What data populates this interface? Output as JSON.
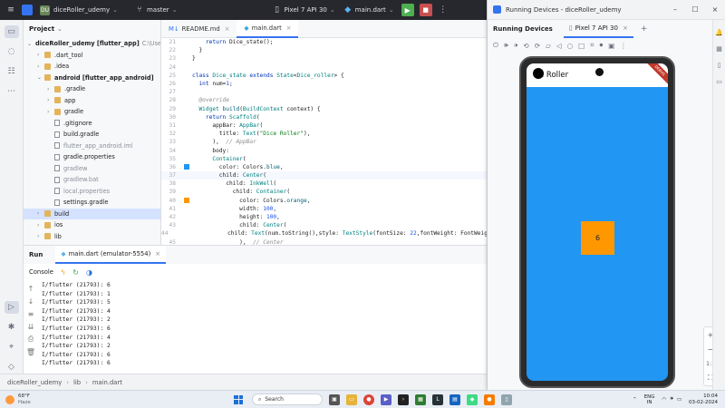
{
  "titlebar": {
    "project_badge": "DU",
    "project_name": "diceRoller_udemy",
    "branch": "master",
    "device": "Pixel 7 API 30",
    "run_config": "main.dart"
  },
  "project_panel": {
    "title": "Project",
    "tree": [
      {
        "label": "diceRoller_udemy [flutter_app]",
        "extra": "C:\\Users\\",
        "indent": 0,
        "kind": "folder-blue",
        "expanded": true,
        "bold": true
      },
      {
        "label": ".dart_tool",
        "indent": 1,
        "kind": "folder",
        "expanded": false
      },
      {
        "label": ".idea",
        "indent": 1,
        "kind": "folder",
        "expanded": false
      },
      {
        "label": "android [flutter_app_android]",
        "indent": 1,
        "kind": "folder",
        "expanded": true,
        "bold": true
      },
      {
        "label": ".gradle",
        "indent": 2,
        "kind": "folder",
        "expanded": false
      },
      {
        "label": "app",
        "indent": 2,
        "kind": "folder",
        "expanded": false
      },
      {
        "label": "gradle",
        "indent": 2,
        "kind": "folder",
        "expanded": false
      },
      {
        "label": ".gitignore",
        "indent": 2,
        "kind": "file"
      },
      {
        "label": "build.gradle",
        "indent": 2,
        "kind": "file"
      },
      {
        "label": "flutter_app_android.iml",
        "indent": 2,
        "kind": "file",
        "muted": true
      },
      {
        "label": "gradle.properties",
        "indent": 2,
        "kind": "file"
      },
      {
        "label": "gradlew",
        "indent": 2,
        "kind": "file",
        "muted": true
      },
      {
        "label": "gradlew.bat",
        "indent": 2,
        "kind": "file",
        "muted": true
      },
      {
        "label": "local.properties",
        "indent": 2,
        "kind": "file",
        "muted": true
      },
      {
        "label": "settings.gradle",
        "indent": 2,
        "kind": "file"
      },
      {
        "label": "build",
        "indent": 1,
        "kind": "folder",
        "expanded": false,
        "selected": true
      },
      {
        "label": "ios",
        "indent": 1,
        "kind": "folder",
        "expanded": false
      },
      {
        "label": "lib",
        "indent": 1,
        "kind": "folder",
        "expanded": false
      }
    ]
  },
  "editor": {
    "tabs": [
      {
        "label": "README.md",
        "prefix": "M↓",
        "active": false
      },
      {
        "label": "main.dart",
        "active": true
      }
    ],
    "lines": [
      {
        "n": "21",
        "html": "    <span class='kw'>return</span> Dice_state();"
      },
      {
        "n": "22",
        "html": "  }"
      },
      {
        "n": "23",
        "html": "}"
      },
      {
        "n": "24",
        "html": ""
      },
      {
        "n": "25",
        "html": "<span class='kw'>class</span> <span class='cls'>Dice_state</span> <span class='kw'>extends</span> <span class='cls'>State</span>&lt;<span class='cls'>Dice_roller</span>&gt; {"
      },
      {
        "n": "26",
        "html": "  <span class='kw'>int</span> num=<span class='num'>1</span>;"
      },
      {
        "n": "27",
        "html": ""
      },
      {
        "n": "28",
        "html": "  <span class='cm'>@override</span>"
      },
      {
        "n": "29",
        "html": "  <span class='cls'>Widget</span> <span class='fn'>build</span>(<span class='cls'>BuildContext</span> context) {"
      },
      {
        "n": "30",
        "html": "    <span class='kw'>return</span> <span class='cls'>Scaffold</span>("
      },
      {
        "n": "31",
        "html": "      appBar: <span class='cls'>AppBar</span>("
      },
      {
        "n": "32",
        "html": "        title: <span class='cls'>Text</span>(<span class='str'>\"Dice Roller\"</span>),"
      },
      {
        "n": "33",
        "html": "      ),  <span class='cm'>// AppBar</span>"
      },
      {
        "n": "34",
        "html": "      body:"
      },
      {
        "n": "35",
        "html": "      <span class='cls'>Container</span>("
      },
      {
        "n": "36",
        "html": "        color: Colors.<span class='fn'>blue</span>,",
        "marker": "#2196f3"
      },
      {
        "n": "37",
        "html": "        child: <span class='cls'>Center</span>(",
        "highlight": true
      },
      {
        "n": "38",
        "html": "          child: <span class='cls'>InkWell</span>("
      },
      {
        "n": "39",
        "html": "            child: <span class='cls'>Container</span>("
      },
      {
        "n": "40",
        "html": "              color: Colors.<span class='fn'>orange</span>,",
        "marker": "#ff9800"
      },
      {
        "n": "41",
        "html": "              width: <span class='num'>100</span>,"
      },
      {
        "n": "42",
        "html": "              height: <span class='num'>100</span>,"
      },
      {
        "n": "43",
        "html": "              child: <span class='cls'>Center</span>("
      },
      {
        "n": "44",
        "html": "                child: <span class='cls'>Text</span>(num.toString(),style: <span class='cls'>TextStyle</span>(fontSize: <span class='num'>22</span>,fontWeight: FontWeight.<span class='fn'>w</span>"
      },
      {
        "n": "45",
        "html": "              ),  <span class='cm'>// Center</span>"
      }
    ]
  },
  "run_panel": {
    "title": "Run",
    "tab_label": "main.dart (emulator-5554)",
    "console_label": "Console",
    "log_lines": [
      "I/flutter (21793): 6",
      "I/flutter (21793): 1",
      "I/flutter (21793): 5",
      "I/flutter (21793): 4",
      "I/flutter (21793): 2",
      "I/flutter (21793): 6",
      "I/flutter (21793): 4",
      "I/flutter (21793): 2",
      "I/flutter (21793): 6",
      "I/flutter (21793): 6"
    ]
  },
  "statusbar": {
    "crumbs": [
      "diceRoller_udemy",
      "lib",
      "main.dart"
    ]
  },
  "running_devices": {
    "window_title": "Running Devices - diceRoller_udemy",
    "header": "Running Devices",
    "device_tab": "Pixel 7 API 30",
    "app_title": "e Roller",
    "debug_ribbon": "DEBUG",
    "dice_value": "6",
    "zoom_reset": "1:1",
    "colors": {
      "screen": "#2196f3",
      "dice": "#ff9800"
    }
  },
  "taskbar": {
    "weather_temp": "68°F",
    "weather_desc": "Haze",
    "search_placeholder": "Search",
    "lang_top": "ENG",
    "lang_bottom": "IN",
    "time": "10:04",
    "date": "03-02-2024"
  }
}
